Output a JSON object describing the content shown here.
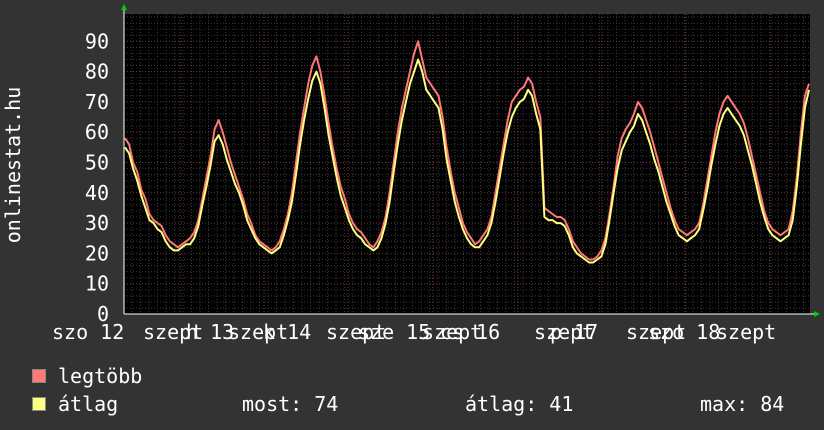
{
  "chart_data": {
    "type": "line",
    "ylabel": "onlinestat.hu",
    "yticks": [
      0,
      10,
      20,
      30,
      40,
      50,
      60,
      70,
      80,
      90
    ],
    "ylim": [
      0,
      99
    ],
    "x_tick_labels": [
      "szo 12",
      "szept",
      "h 13",
      "szept",
      "k 14",
      "szept",
      "sze 15",
      "szept",
      "cs 16",
      "szept",
      "p 17",
      "szept",
      "szo 18",
      "szept"
    ],
    "grid": true,
    "legend_placement": "bottom-left",
    "series": [
      {
        "name": "legtöbb",
        "color": "#ff7777",
        "values": [
          58,
          56,
          50,
          47,
          41,
          38,
          33,
          31,
          30,
          29,
          26,
          24,
          23,
          22,
          23,
          24,
          25,
          27,
          31,
          38,
          45,
          52,
          61,
          64,
          60,
          55,
          50,
          46,
          42,
          38,
          33,
          30,
          26,
          24,
          23,
          22,
          21,
          22,
          24,
          28,
          33,
          40,
          50,
          60,
          68,
          76,
          82,
          85,
          80,
          72,
          63,
          55,
          48,
          42,
          38,
          33,
          30,
          28,
          27,
          25,
          23,
          22,
          24,
          27,
          32,
          40,
          50,
          60,
          68,
          74,
          80,
          86,
          90,
          84,
          78,
          76,
          74,
          72,
          65,
          55,
          47,
          40,
          35,
          30,
          27,
          25,
          23,
          24,
          26,
          28,
          32,
          40,
          48,
          56,
          64,
          70,
          72,
          74,
          75,
          78,
          76,
          70,
          65,
          35,
          34,
          33,
          32,
          32,
          31,
          28,
          24,
          22,
          20,
          19,
          18,
          18,
          19,
          21,
          25,
          33,
          42,
          52,
          58,
          61,
          63,
          66,
          70,
          68,
          64,
          60,
          55,
          50,
          45,
          40,
          35,
          31,
          28,
          27,
          26,
          27,
          28,
          30,
          36,
          44,
          52,
          60,
          66,
          70,
          72,
          70,
          68,
          66,
          63,
          58,
          52,
          46,
          40,
          34,
          30,
          28,
          27,
          26,
          27,
          28,
          34,
          45,
          60,
          72,
          76
        ]
      },
      {
        "name": "átlag",
        "color": "#ffff80",
        "values": [
          55,
          53,
          48,
          44,
          39,
          35,
          31,
          30,
          28,
          27,
          24,
          22,
          21,
          21,
          22,
          23,
          23,
          25,
          29,
          36,
          42,
          49,
          57,
          59,
          56,
          51,
          47,
          43,
          40,
          36,
          31,
          28,
          25,
          23,
          22,
          21,
          20,
          21,
          22,
          26,
          31,
          37,
          46,
          56,
          64,
          71,
          77,
          80,
          76,
          68,
          59,
          52,
          45,
          39,
          35,
          31,
          28,
          26,
          25,
          23,
          22,
          21,
          22,
          25,
          30,
          37,
          47,
          56,
          64,
          70,
          76,
          80,
          84,
          80,
          74,
          72,
          70,
          68,
          61,
          51,
          44,
          37,
          32,
          28,
          25,
          23,
          22,
          22,
          24,
          26,
          30,
          37,
          45,
          53,
          60,
          65,
          68,
          70,
          71,
          74,
          72,
          66,
          61,
          32,
          31,
          31,
          30,
          30,
          29,
          26,
          22,
          20,
          19,
          18,
          17,
          17,
          18,
          19,
          23,
          31,
          40,
          48,
          54,
          57,
          60,
          62,
          66,
          64,
          60,
          56,
          51,
          47,
          42,
          37,
          33,
          29,
          26,
          25,
          24,
          25,
          26,
          28,
          34,
          41,
          49,
          56,
          62,
          66,
          68,
          66,
          64,
          62,
          59,
          54,
          49,
          43,
          37,
          32,
          28,
          26,
          25,
          24,
          25,
          26,
          31,
          42,
          56,
          68,
          74
        ]
      }
    ]
  },
  "legend": {
    "items": [
      {
        "label": "legtöbb",
        "color": "#ff7777"
      },
      {
        "label": "átlag",
        "color": "#ffff80"
      }
    ]
  },
  "stats": {
    "current_label": "most:",
    "current_value": "74",
    "average_label": "átlag:",
    "average_value": "41",
    "max_label": "max:",
    "max_value": "84"
  }
}
